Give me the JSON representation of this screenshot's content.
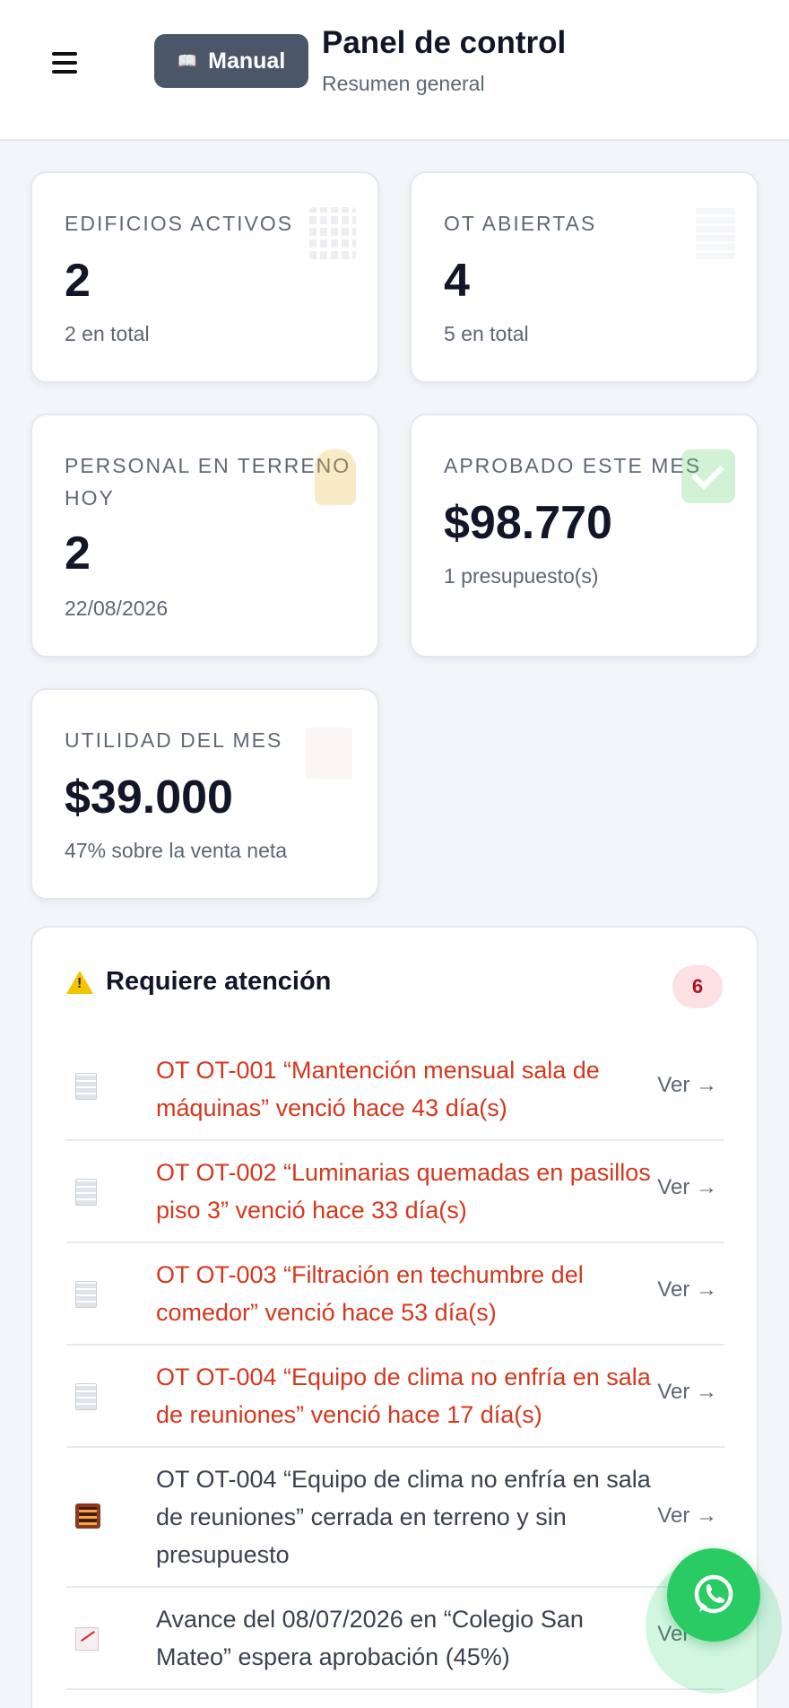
{
  "header": {
    "menu_icon": "hamburger-menu-icon",
    "manual_label": "Manual",
    "manual_icon": "book-icon",
    "title": "Panel de control",
    "subtitle": "Resumen general"
  },
  "stats": [
    {
      "label": "EDIFICIOS ACTIVOS",
      "value": "2",
      "sub": "2 en total",
      "icon": "building-icon"
    },
    {
      "label": "OT ABIERTAS",
      "value": "4",
      "sub": "5 en total",
      "icon": "receipt-icon"
    },
    {
      "label": "PERSONAL EN TERRENO HOY",
      "value": "2",
      "sub": "22/08/2026",
      "icon": "worker-icon"
    },
    {
      "label": "APROBADO ESTE MES",
      "value": "$98.770",
      "sub": "1 presupuesto(s)",
      "icon": "check-icon"
    },
    {
      "label": "UTILIDAD DEL MES",
      "value": "$39.000",
      "sub": "47% sobre la venta neta",
      "icon": "chart-up-icon"
    }
  ],
  "attention": {
    "title": "Requiere atención",
    "icon": "warning-icon",
    "count": "6",
    "link_label": "Ver →",
    "items": [
      {
        "text": "OT OT-001 “Mantención mensual sala de máquinas” venció hace 43 día(s)",
        "icon": "receipt-icon",
        "status": "overdue"
      },
      {
        "text": "OT OT-002 “Luminarias quemadas en pasillos piso 3” venció hace 33 día(s)",
        "icon": "receipt-icon",
        "status": "overdue"
      },
      {
        "text": "OT OT-003 “Filtración en techumbre del comedor” venció hace 53 día(s)",
        "icon": "receipt-icon",
        "status": "overdue"
      },
      {
        "text": "OT OT-004 “Equipo de clima no enfría en sala de reuniones” venció hace 17 día(s)",
        "icon": "receipt-icon",
        "status": "overdue"
      },
      {
        "text": "OT OT-004 “Equipo de clima no enfría en sala de reuniones” cerrada en terreno y sin presupuesto",
        "icon": "abacus-icon",
        "status": "normal"
      },
      {
        "text": "Avance del 08/07/2026 en “Colegio San Mateo” espera aprobación (45%)",
        "icon": "chart-up-icon",
        "status": "normal"
      }
    ]
  },
  "fab": {
    "icon": "whatsapp-icon",
    "color": "#29cc63"
  },
  "colors": {
    "overdue": "#d4381e",
    "accent": "#4b5769",
    "badge_bg": "#fce0e2",
    "badge_fg": "#b0121e"
  }
}
